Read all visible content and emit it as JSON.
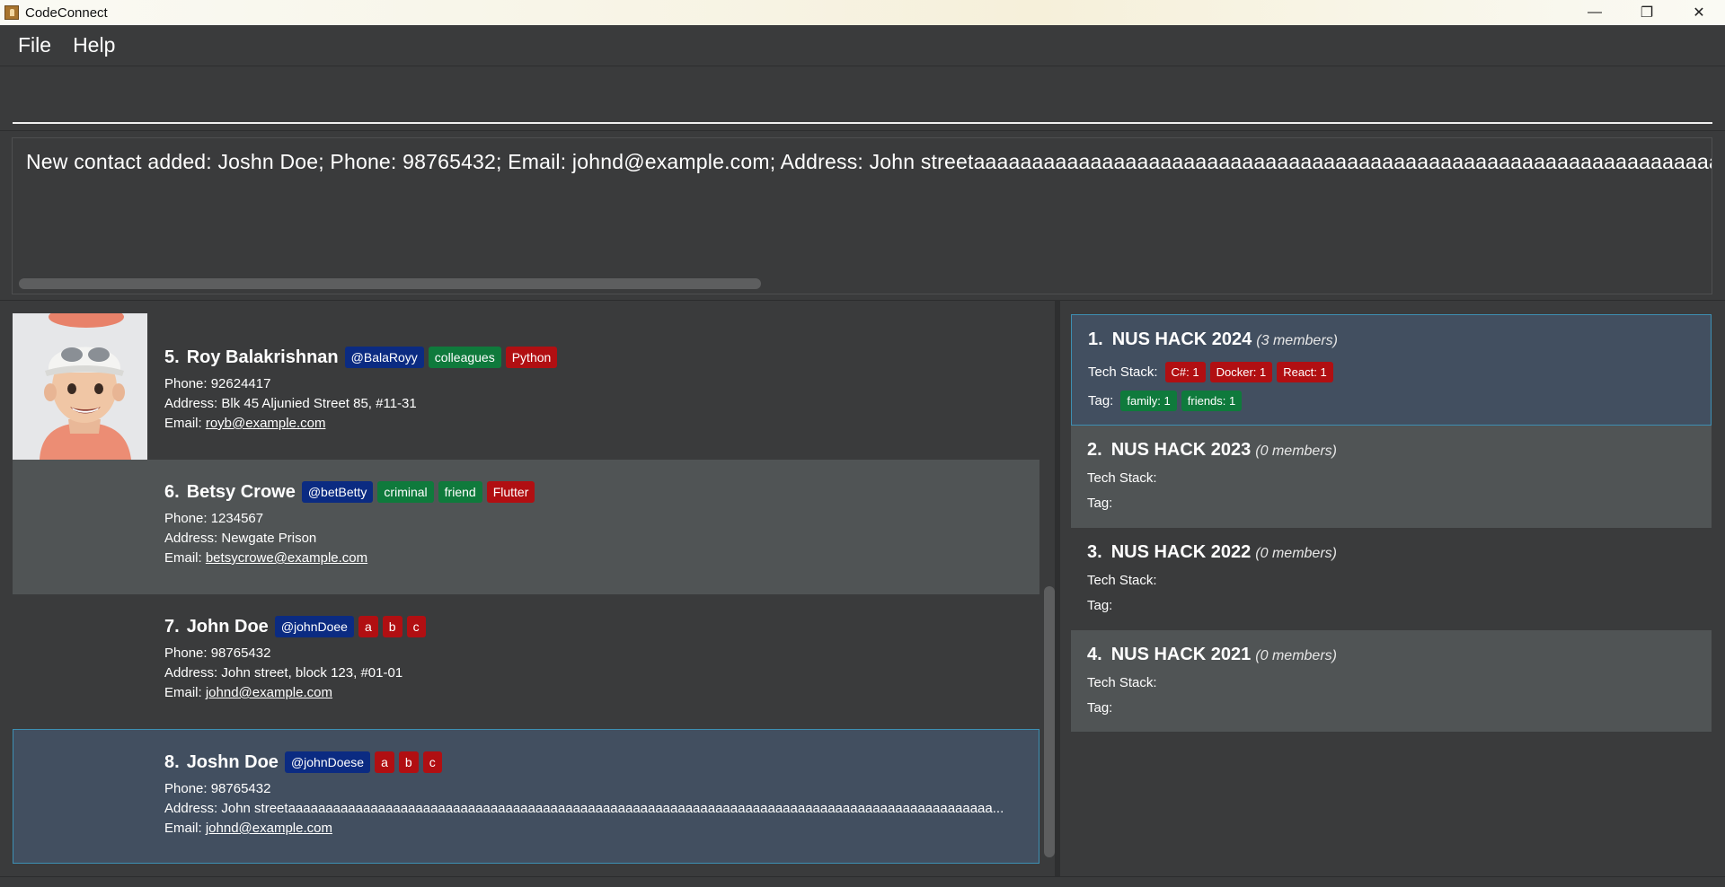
{
  "window": {
    "title": "CodeConnect",
    "controls": {
      "minimize": "—",
      "maximize": "❐",
      "close": "✕"
    }
  },
  "menu": {
    "file": "File",
    "help": "Help"
  },
  "command": {
    "value": "",
    "placeholder": ""
  },
  "result": {
    "text": "New contact added: Joshn Doe; Phone: 98765432; Email: johnd@example.com; Address: John streetaaaaaaaaaaaaaaaaaaaaaaaaaaaaaaaaaaaaaaaaaaaaaaaaaaaaaaaaaaaaaaaaaaaaaaaaaaaaaaaa"
  },
  "persons": [
    {
      "index": "5.",
      "name": "Roy Balakrishnan",
      "handle": "@BalaRoyy",
      "tags": [
        "colleagues"
      ],
      "tech": [
        "Python"
      ],
      "phone": "Phone: 92624417",
      "address": "Address: Blk 45 Aljunied Street 85, #11-31",
      "email_label": "Email: ",
      "email": "royb@example.com"
    },
    {
      "index": "6.",
      "name": "Betsy Crowe",
      "handle": "@betBetty",
      "tags": [
        "criminal",
        "friend"
      ],
      "tech": [
        "Flutter"
      ],
      "phone": "Phone: 1234567",
      "address": "Address: Newgate Prison",
      "email_label": "Email: ",
      "email": "betsycrowe@example.com"
    },
    {
      "index": "7.",
      "name": "John Doe",
      "handle": "@johnDoee",
      "tags": [],
      "tech": [
        "a",
        "b",
        "c"
      ],
      "phone": "Phone: 98765432",
      "address": "Address: John street, block 123, #01-01",
      "email_label": "Email: ",
      "email": "johnd@example.com"
    },
    {
      "index": "8.",
      "name": "Joshn Doe",
      "handle": "@johnDoese",
      "tags": [],
      "tech": [
        "a",
        "b",
        "c"
      ],
      "phone": "Phone: 98765432",
      "address": "Address: John streetaaaaaaaaaaaaaaaaaaaaaaaaaaaaaaaaaaaaaaaaaaaaaaaaaaaaaaaaaaaaaaaaaaaaaaaaaaaaaaaaaaaaaaaaaaaaaa...",
      "email_label": "Email: ",
      "email": "johnd@example.com"
    }
  ],
  "groups": [
    {
      "index": "1.",
      "name": "NUS HACK 2024",
      "count": "(3 members)",
      "tech_label": "Tech Stack:",
      "tech": [
        "C#: 1",
        "Docker: 1",
        "React: 1"
      ],
      "tag_label": "Tag:",
      "tags": [
        "family: 1",
        "friends: 1"
      ]
    },
    {
      "index": "2.",
      "name": "NUS HACK 2023",
      "count": "(0 members)",
      "tech_label": "Tech Stack:",
      "tech": [],
      "tag_label": "Tag:",
      "tags": []
    },
    {
      "index": "3.",
      "name": "NUS HACK 2022",
      "count": "(0 members)",
      "tech_label": "Tech Stack:",
      "tech": [],
      "tag_label": "Tag:",
      "tags": []
    },
    {
      "index": "4.",
      "name": "NUS HACK 2021",
      "count": "(0 members)",
      "tech_label": "Tech Stack:",
      "tech": [],
      "tag_label": "Tag:",
      "tags": []
    }
  ],
  "colors": {
    "background": "#3a3b3c",
    "selected": "#424f60",
    "selected_border": "#3d8fb3",
    "handle_tag": "#0b2b82",
    "general_tag": "#0f7a3c",
    "tech_tag": "#b10f12"
  }
}
